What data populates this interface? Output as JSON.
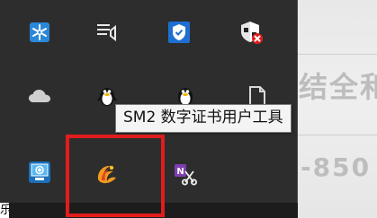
{
  "background_app": {
    "text_line_1": "结全和",
    "text_line_2": "-850"
  },
  "tray": {
    "icons": [
      {
        "name": "snowflake-app-icon",
        "color": "#2b88d8"
      },
      {
        "name": "action-center-icon",
        "color": "#e8e8e8"
      },
      {
        "name": "defender-shield-icon",
        "color": "#1f6fd1"
      },
      {
        "name": "security-alert-icon",
        "color": "#e01e1e"
      },
      {
        "name": "onedrive-cloud-icon",
        "color": "#cfcfcf"
      },
      {
        "name": "qq-penguin-icon",
        "color": "#ffffff"
      },
      {
        "name": "qq-penguin-icon-2",
        "color": "#ffffff"
      },
      {
        "name": "document-icon",
        "color": "#d8d8d8"
      },
      {
        "name": "network-monitor-icon",
        "color": "#2f8fe0"
      },
      {
        "name": "sm2-certificate-tool-icon",
        "color": "#f39a1e"
      },
      {
        "name": "onenote-clip-icon",
        "color": "#7e3fb0"
      }
    ]
  },
  "tooltip": {
    "text": "SM2 数字证书用户工具"
  },
  "highlight": {
    "color": "#e11c1c"
  },
  "edge_glyph": "乐"
}
